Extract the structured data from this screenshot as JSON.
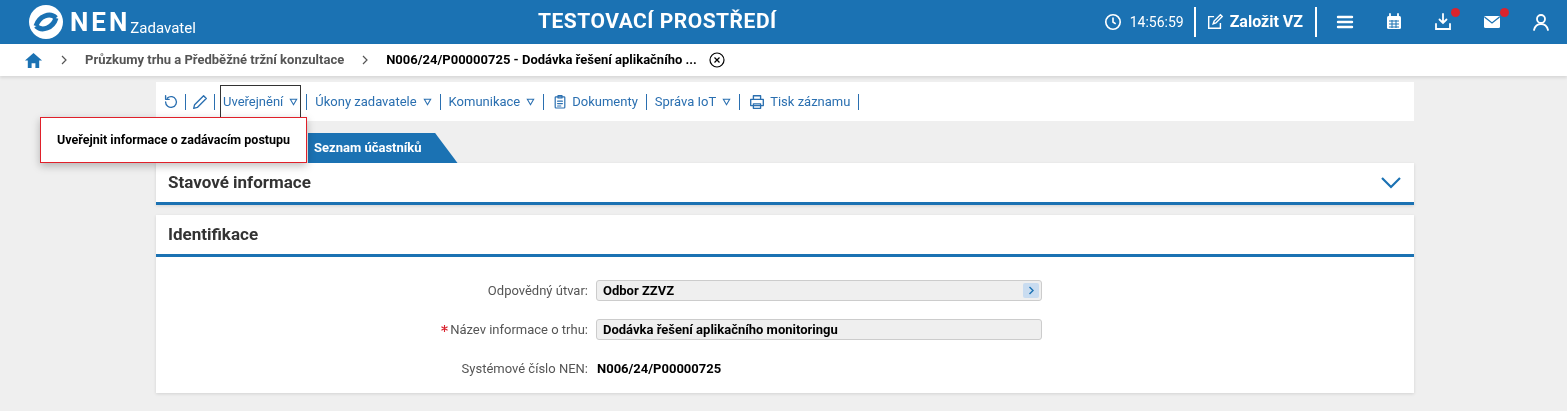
{
  "header": {
    "logo": "NEN",
    "subtitle": "Zadavatel",
    "environment": "TESTOVACÍ PROSTŘEDÍ",
    "time": "14:56:59",
    "create_button": "Založit VZ",
    "icons": [
      {
        "kind": "menu",
        "badge": false
      },
      {
        "kind": "calendar",
        "badge": false
      },
      {
        "kind": "download",
        "badge": true
      },
      {
        "kind": "mail",
        "badge": true
      },
      {
        "kind": "user",
        "badge": false
      }
    ]
  },
  "breadcrumbs": [
    "Průzkumy trhu a Předběžné tržní konzultace",
    "N006/24/P00000725 - Dodávka řešení aplikačního ..."
  ],
  "toolbar": [
    {
      "kind": "refresh"
    },
    {
      "kind": "edit"
    },
    {
      "kind": "menu",
      "label": "Uveřejnění",
      "selected": true
    },
    {
      "kind": "menu",
      "label": "Úkony zadavatele",
      "selected": false
    },
    {
      "kind": "menu",
      "label": "Komunikace",
      "selected": false
    },
    {
      "kind": "document",
      "label": "Dokumenty"
    },
    {
      "kind": "menu",
      "label": "Správa IoT",
      "selected": false
    },
    {
      "kind": "print",
      "label": "Tisk záznamu"
    }
  ],
  "dropdown": [
    "Uveřejnit informace o zadávacím postupu"
  ],
  "tabs": [
    {
      "label": "Seznam účastníků",
      "selected": true
    }
  ],
  "sections": [
    {
      "title": "Stavové informace",
      "expanded": false
    },
    {
      "title": "Identifikace",
      "expanded": true,
      "fields": [
        {
          "label": "Odpovědný útvar:",
          "required": false,
          "kind": "lookup",
          "value": "Odbor ZZVZ"
        },
        {
          "label": "Název informace o trhu:",
          "required": true,
          "kind": "text",
          "value": "Dodávka řešení aplikačního monitoringu"
        },
        {
          "label": "Systémové číslo NEN:",
          "required": false,
          "kind": "readonly",
          "value": "N006/24/P00000725"
        }
      ]
    }
  ]
}
